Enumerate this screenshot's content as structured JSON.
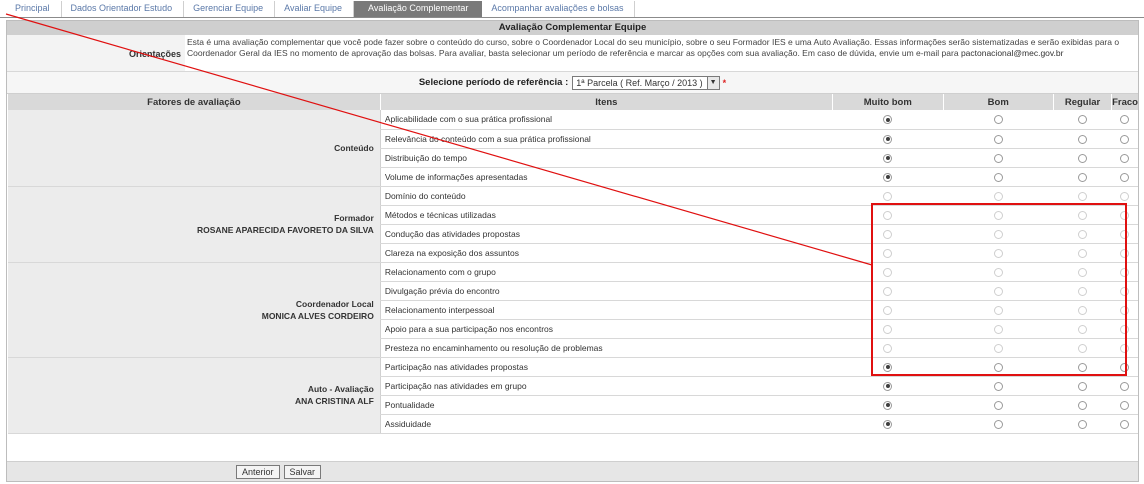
{
  "tabs": [
    {
      "label": "Principal",
      "active": false
    },
    {
      "label": "Dados Orientador Estudo",
      "active": false
    },
    {
      "label": "Gerenciar Equipe",
      "active": false
    },
    {
      "label": "Avaliar Equipe",
      "active": false
    },
    {
      "label": "Avaliação Complementar",
      "active": true
    },
    {
      "label": "Acompanhar avaliações e bolsas",
      "active": false
    }
  ],
  "title": "Avaliação Complementar Equipe",
  "orientacoes": {
    "label": "Orientações",
    "text": "Esta é uma avaliação complementar que você pode fazer sobre o conteúdo do curso, sobre o Coordenador Local do seu município, sobre o seu Formador IES e uma Auto Avaliação. Essas informações serão sistematizadas e serão exibidas para o Coordenador Geral da IES no momento de aprovação das bolsas. Para avaliar, basta selecionar um período de referência e marcar as opções com sua avaliação. Em caso de dúvida, envie um e-mail para",
    "email": "pactonacional@mec.gov.br"
  },
  "period": {
    "label": "Selecione período de referência :",
    "value": "1ª Parcela ( Ref. Março / 2013 )",
    "required_mark": "*"
  },
  "table": {
    "headers": [
      "Fatores de avaliação",
      "Itens",
      "Muito bom",
      "Bom",
      "Regular",
      "Fraco"
    ],
    "groups": [
      {
        "label": "Conteúdo",
        "name": "",
        "items": [
          {
            "text": "Aplicabilidade com o sua prática profissional",
            "selected": 0,
            "disabled": false
          },
          {
            "text": "Relevância do conteúdo com a sua prática profissional",
            "selected": 0,
            "disabled": false
          },
          {
            "text": "Distribuição do tempo",
            "selected": 0,
            "disabled": false
          },
          {
            "text": "Volume de informações apresentadas",
            "selected": 0,
            "disabled": false
          }
        ]
      },
      {
        "label": "Formador",
        "name": "ROSANE APARECIDA FAVORETO DA SILVA",
        "items": [
          {
            "text": "Domínio do conteúdo",
            "selected": -1,
            "disabled": true
          },
          {
            "text": "Métodos e técnicas utilizadas",
            "selected": -1,
            "disabled": true
          },
          {
            "text": "Condução das atividades propostas",
            "selected": -1,
            "disabled": true
          },
          {
            "text": "Clareza na exposição dos assuntos",
            "selected": -1,
            "disabled": true
          }
        ]
      },
      {
        "label": "Coordenador Local",
        "name": "MONICA ALVES CORDEIRO",
        "items": [
          {
            "text": "Relacionamento com o grupo",
            "selected": -1,
            "disabled": true
          },
          {
            "text": "Divulgação prévia do encontro",
            "selected": -1,
            "disabled": true
          },
          {
            "text": "Relacionamento interpessoal",
            "selected": -1,
            "disabled": true
          },
          {
            "text": "Apoio para a sua participação nos encontros",
            "selected": -1,
            "disabled": true
          },
          {
            "text": "Presteza no encaminhamento ou resolução de problemas",
            "selected": -1,
            "disabled": true
          }
        ]
      },
      {
        "label": "Auto - Avaliação",
        "name": "ANA CRISTINA ALF",
        "items": [
          {
            "text": "Participação nas atividades propostas",
            "selected": 0,
            "disabled": false
          },
          {
            "text": "Participação nas atividades em grupo",
            "selected": 0,
            "disabled": false
          },
          {
            "text": "Pontualidade",
            "selected": 0,
            "disabled": false
          },
          {
            "text": "Assiduidade",
            "selected": 0,
            "disabled": false
          }
        ]
      }
    ]
  },
  "buttons": {
    "back": "Anterior",
    "save": "Salvar"
  },
  "colors": {
    "annotation": "#e01010",
    "tab_active": "#7a7a7a",
    "link": "#5a78a8"
  }
}
